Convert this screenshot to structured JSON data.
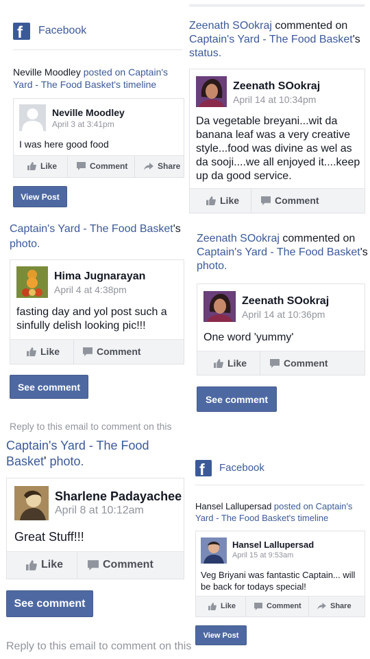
{
  "left": {
    "email1": {
      "brand": "Facebook",
      "logo_letter": "f",
      "actor": "Neville Moodley",
      "verb": "posted on Captain's Yard - The Food Basket's timeline",
      "post": {
        "author": "Neville Moodley",
        "time": "April 3 at 3:41pm",
        "text": "I was here good food",
        "actions": [
          "Like",
          "Comment",
          "Share"
        ]
      },
      "button": "View Post"
    },
    "email2": {
      "header_page": "Captain's Yard - The Food Basket",
      "header_suffix": "'s",
      "header_object": "photo.",
      "comment": {
        "author": "Hima Jugnarayan",
        "time": "April 4 at 4:38pm",
        "text": "fasting day and yol post such a sinfully delish looking pic!!!",
        "actions": [
          "Like",
          "Comment"
        ]
      },
      "button": "See comment",
      "reply_note": "Reply to this email to comment on this"
    },
    "email3": {
      "header_page": "Captain's Yard - The Food Basket",
      "header_suffix": "'",
      "header_object": "photo.",
      "comment": {
        "author": "Sharlene Padayachee",
        "time": "April 8 at 10:12am",
        "text": "Great Stuff!!!",
        "actions": [
          "Like",
          "Comment"
        ]
      },
      "button": "See comment",
      "reply_note": "Reply to this email to comment on this"
    }
  },
  "right": {
    "email1": {
      "actor": "Zeenath SOokraj",
      "verb": "commented on",
      "page": "Captain's Yard - The Food Basket",
      "suffix": "'s",
      "object": "status.",
      "comment": {
        "author": "Zeenath SOokraj",
        "time": "April 14 at 10:34pm",
        "text": "Da vegetable breyani...wit da banana leaf was a very creative style...food was divine as wel as da sooji....we all enjoyed it....keep up da good service.",
        "actions": [
          "Like",
          "Comment"
        ]
      }
    },
    "email2": {
      "actor": "Zeenath SOokraj",
      "verb": "commented on",
      "page": "Captain's Yard - The Food Basket",
      "suffix": "'s",
      "object": "photo.",
      "comment": {
        "author": "Zeenath SOokraj",
        "time": "April 14 at 10:36pm",
        "text": "One word 'yummy'",
        "actions": [
          "Like",
          "Comment"
        ]
      },
      "button": "See comment"
    },
    "email3": {
      "brand": "Facebook",
      "logo_letter": "f",
      "actor": "Hansel Lallupersad",
      "verb": "posted on Captain's Yard - The Food Basket's timeline",
      "post": {
        "author": "Hansel Lallupersad",
        "time": "April 15 at 9:53am",
        "text": "Veg Briyani was fantastic Captain... will be back for todays special!",
        "actions": [
          "Like",
          "Comment",
          "Share"
        ]
      },
      "button": "View Post"
    }
  },
  "colors": {
    "brand_blue": "#3b5998",
    "button_blue": "#4e69a2",
    "meta_gray": "#90949c",
    "footer_bg": "#f2f3f5"
  },
  "icons": [
    "facebook-logo-icon",
    "like-thumb-icon",
    "comment-bubble-icon",
    "share-arrow-icon",
    "profile-silhouette-icon"
  ]
}
